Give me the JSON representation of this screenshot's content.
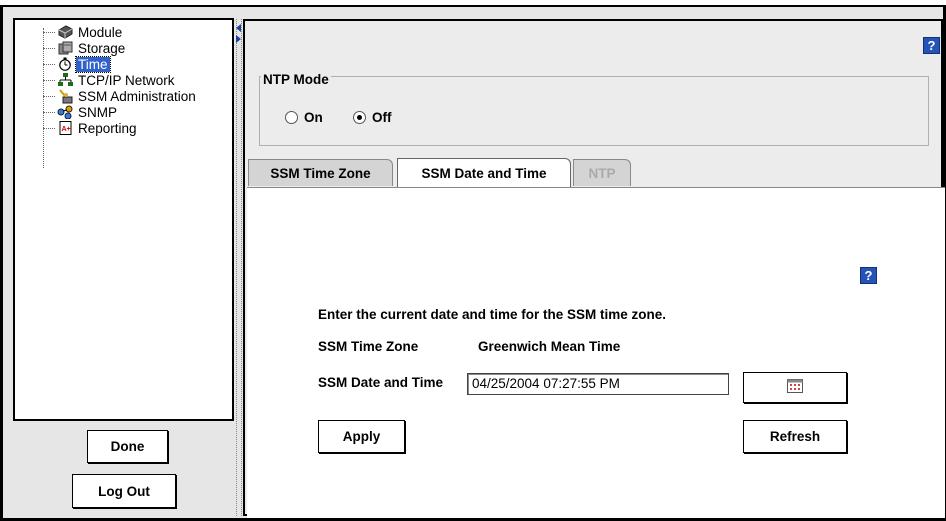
{
  "sidebar": {
    "items": [
      {
        "label": "Module",
        "icon": "module-icon"
      },
      {
        "label": "Storage",
        "icon": "storage-icon"
      },
      {
        "label": "Time",
        "icon": "stopwatch-icon",
        "selected": true
      },
      {
        "label": "TCP/IP Network",
        "icon": "network-icon"
      },
      {
        "label": "SSM Administration",
        "icon": "admin-icon"
      },
      {
        "label": "SNMP",
        "icon": "snmp-icon"
      },
      {
        "label": "Reporting",
        "icon": "report-icon"
      }
    ],
    "done_label": "Done",
    "logout_label": "Log Out"
  },
  "help_label": "?",
  "ntp_mode": {
    "title": "NTP Mode",
    "on_label": "On",
    "off_label": "Off",
    "selected": "Off"
  },
  "tabs": [
    {
      "label": "SSM Time Zone",
      "state": "inactive"
    },
    {
      "label": "SSM Date and Time",
      "state": "active"
    },
    {
      "label": "NTP",
      "state": "disabled"
    }
  ],
  "date_time": {
    "instruction": "Enter the current date and time for the SSM time zone.",
    "tz_label": "SSM Time Zone",
    "tz_value": "Greenwich Mean Time",
    "dt_label": "SSM Date and Time",
    "dt_value": "04/25/2004 07:27:55 PM",
    "apply_label": "Apply",
    "refresh_label": "Refresh",
    "calendar_icon": "calendar-icon"
  },
  "colors": {
    "selection": "#3162c8",
    "help_button": "#2454b5",
    "panel_bg": "#ececec"
  }
}
